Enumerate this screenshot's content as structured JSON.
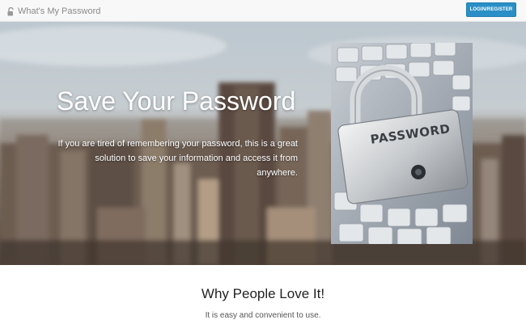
{
  "navbar": {
    "brand_icon": "unlocked-padlock-icon",
    "brand_label": "What's My Password",
    "login_label": "LOGIN/REGISTER",
    "accent_color": "#2a8fc6"
  },
  "hero": {
    "background": "blurred-city-skyline-photo",
    "title": "Save Your Password",
    "description": "If you are tired of remembering your password, this is a great solution to save your information and access it from anywhere.",
    "image": {
      "subject": "padlock-on-keyboard-photo",
      "lock_text": "PASSWORD"
    }
  },
  "why": {
    "title": "Why People Love It!",
    "text": "It is easy and convenient to use."
  }
}
